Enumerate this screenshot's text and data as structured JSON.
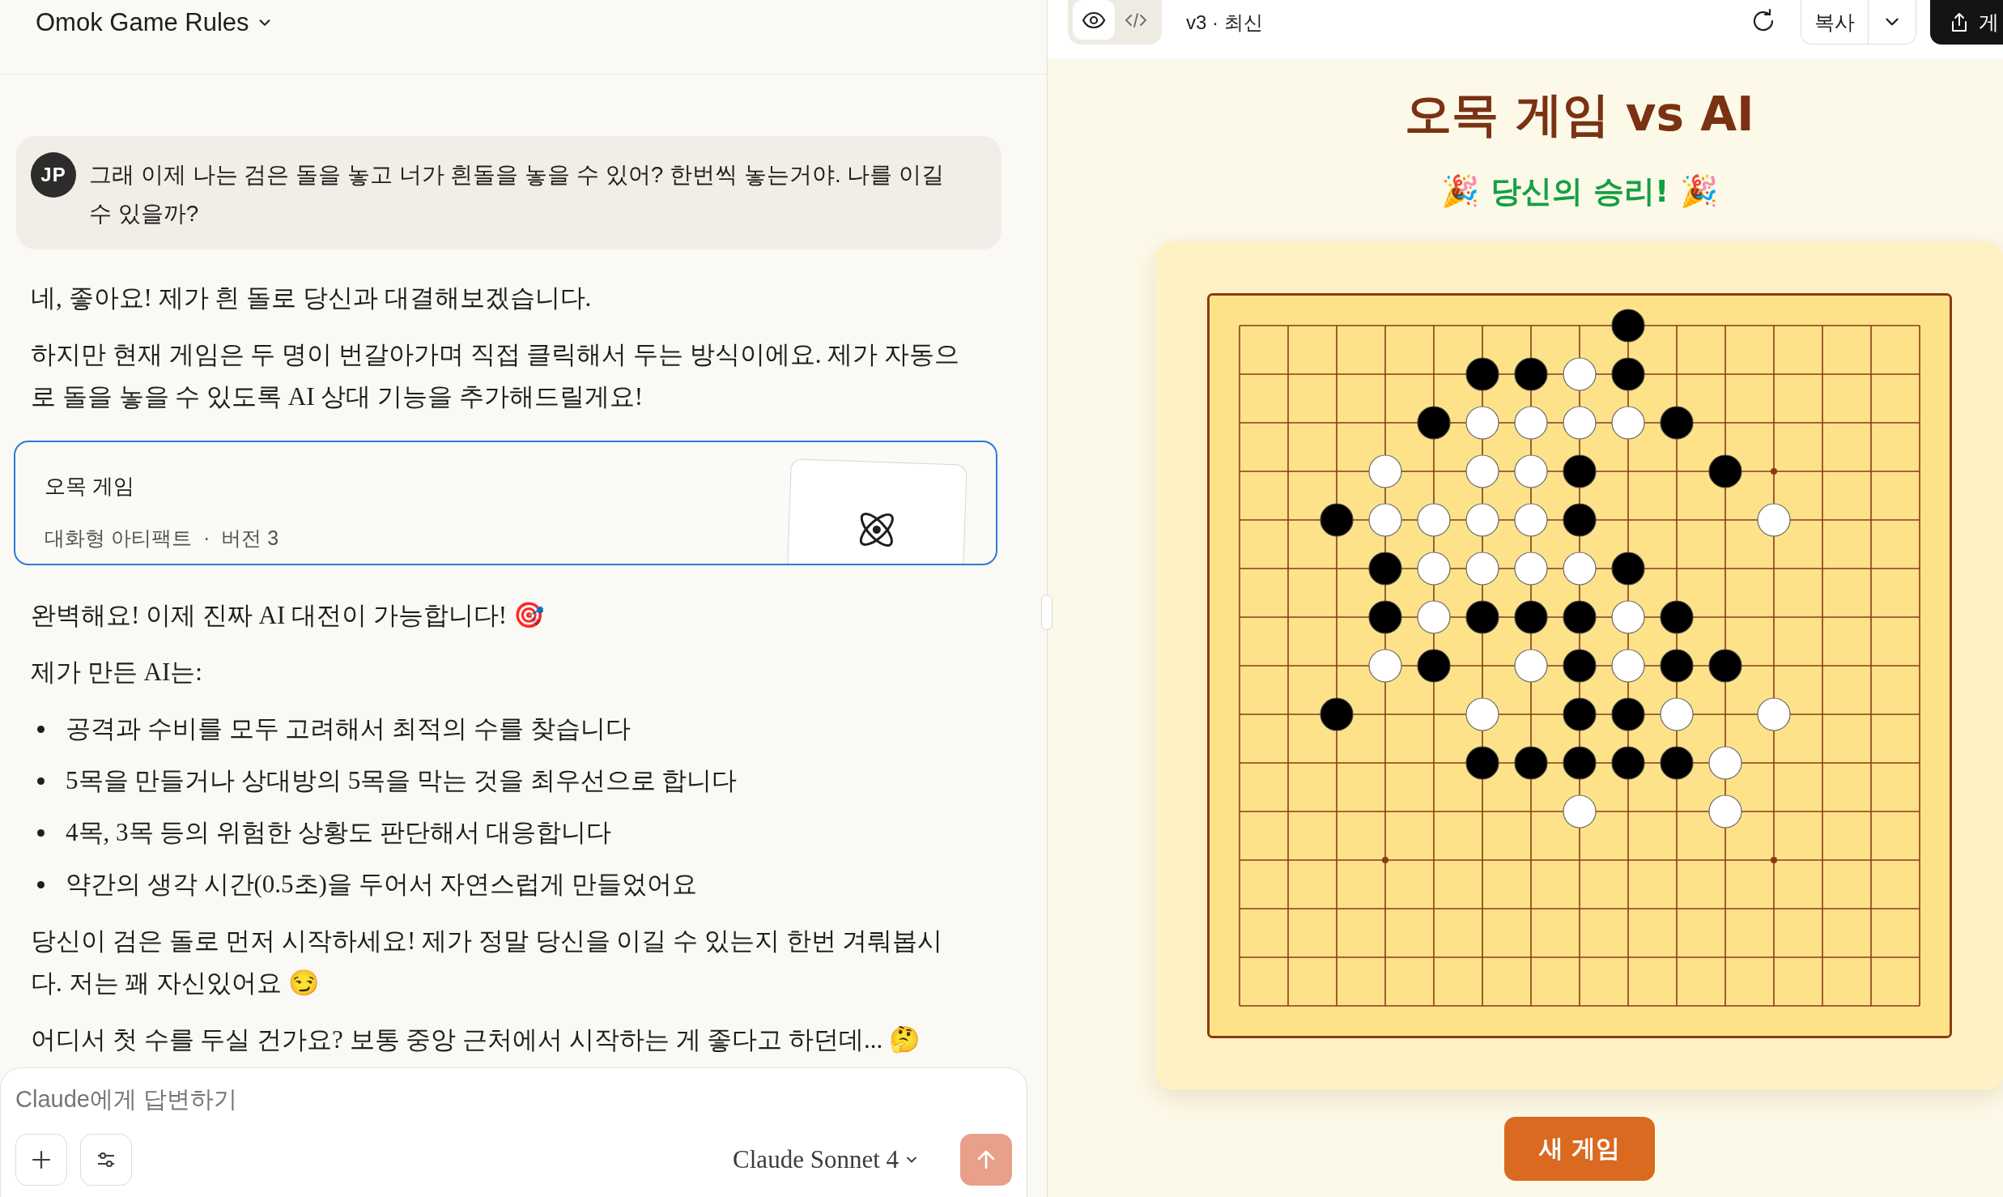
{
  "header": {
    "title": "Omok Game Rules"
  },
  "user_message": {
    "avatar": "JP",
    "text": "그래 이제 나는 검은 돌을 놓고 너가 흰돌을 놓을 수 있어? 한번씩 놓는거야. 나를 이길 수 있을까?"
  },
  "assistant": [
    {
      "kind": "paragraph",
      "text": "네, 좋아요! 제가 흰 돌로 당신과 대결해보겠습니다."
    },
    {
      "kind": "paragraph",
      "text": "하지만 현재 게임은 두 명이 번갈아가며 직접 클릭해서 두는 방식이에요. 제가 자동으로 돌을 놓을 수 있도록 AI 상대 기능을 추가해드릴게요!"
    },
    {
      "kind": "artifact",
      "title": "오목 게임",
      "subtitle": "대화형 아티팩트",
      "separator": "·",
      "version": "버전 3"
    },
    {
      "kind": "paragraph",
      "text": "완벽해요! 이제 진짜 AI 대전이 가능합니다! 🎯"
    },
    {
      "kind": "paragraph",
      "text": "제가 만든 AI는:"
    },
    {
      "kind": "list",
      "items": [
        "공격과 수비를 모두 고려해서 최적의 수를 찾습니다",
        "5목을 만들거나 상대방의 5목을 막는 것을 최우선으로 합니다",
        "4목, 3목 등의 위험한 상황도 판단해서 대응합니다",
        "약간의 생각 시간(0.5초)을 두어서 자연스럽게 만들었어요"
      ]
    },
    {
      "kind": "paragraph",
      "text": "당신이 검은 돌로 먼저 시작하세요! 제가 정말 당신을 이길 수 있는지 한번 겨뤄봅시다. 저는 꽤 자신있어요 😏"
    },
    {
      "kind": "paragraph",
      "text": "어디서 첫 수를 두실 건가요? 보통 중앙 근처에서 시작하는 게 좋다고 하던데... 🤔"
    }
  ],
  "composer": {
    "placeholder": "Claude에게 답변하기",
    "model": "Claude Sonnet 4"
  },
  "artifact_toolbar": {
    "view_modes": [
      {
        "kind": "preview",
        "selected": true
      },
      {
        "kind": "code",
        "selected": false
      }
    ],
    "version": "v3 · 최신",
    "copy": "복사",
    "publish": "게"
  },
  "game": {
    "title": "오목 게임 vs AI",
    "status": "🎉 당신의 승리! 🎉",
    "new_game": "새 게임",
    "board": {
      "rows": [
        {
          "cells": [
            {
              "kind": "none"
            },
            {
              "kind": "none"
            },
            {
              "kind": "none"
            },
            {
              "kind": "none"
            },
            {
              "kind": "none"
            },
            {
              "kind": "none"
            },
            {
              "kind": "none"
            },
            {
              "kind": "none"
            },
            {
              "kind": "black"
            },
            {
              "kind": "none"
            },
            {
              "kind": "none"
            },
            {
              "kind": "none"
            },
            {
              "kind": "none"
            },
            {
              "kind": "none"
            },
            {
              "kind": "none"
            }
          ]
        },
        {
          "cells": [
            {
              "kind": "none"
            },
            {
              "kind": "none"
            },
            {
              "kind": "none"
            },
            {
              "kind": "none"
            },
            {
              "kind": "none"
            },
            {
              "kind": "black"
            },
            {
              "kind": "black"
            },
            {
              "kind": "white"
            },
            {
              "kind": "black"
            },
            {
              "kind": "none"
            },
            {
              "kind": "none"
            },
            {
              "kind": "none"
            },
            {
              "kind": "none"
            },
            {
              "kind": "none"
            },
            {
              "kind": "none"
            }
          ]
        },
        {
          "cells": [
            {
              "kind": "none"
            },
            {
              "kind": "none"
            },
            {
              "kind": "none"
            },
            {
              "kind": "none"
            },
            {
              "kind": "black"
            },
            {
              "kind": "white"
            },
            {
              "kind": "white"
            },
            {
              "kind": "white"
            },
            {
              "kind": "white"
            },
            {
              "kind": "black"
            },
            {
              "kind": "none"
            },
            {
              "kind": "none"
            },
            {
              "kind": "none"
            },
            {
              "kind": "none"
            },
            {
              "kind": "none"
            }
          ]
        },
        {
          "cells": [
            {
              "kind": "none"
            },
            {
              "kind": "none"
            },
            {
              "kind": "none"
            },
            {
              "kind": "white"
            },
            {
              "kind": "none"
            },
            {
              "kind": "white"
            },
            {
              "kind": "white"
            },
            {
              "kind": "black"
            },
            {
              "kind": "none"
            },
            {
              "kind": "none"
            },
            {
              "kind": "black"
            },
            {
              "kind": "star"
            },
            {
              "kind": "none"
            },
            {
              "kind": "none"
            },
            {
              "kind": "none"
            }
          ]
        },
        {
          "cells": [
            {
              "kind": "none"
            },
            {
              "kind": "none"
            },
            {
              "kind": "black"
            },
            {
              "kind": "white"
            },
            {
              "kind": "white"
            },
            {
              "kind": "white"
            },
            {
              "kind": "white"
            },
            {
              "kind": "black"
            },
            {
              "kind": "none"
            },
            {
              "kind": "none"
            },
            {
              "kind": "none"
            },
            {
              "kind": "white"
            },
            {
              "kind": "none"
            },
            {
              "kind": "none"
            },
            {
              "kind": "none"
            }
          ]
        },
        {
          "cells": [
            {
              "kind": "none"
            },
            {
              "kind": "none"
            },
            {
              "kind": "none"
            },
            {
              "kind": "black"
            },
            {
              "kind": "white"
            },
            {
              "kind": "white"
            },
            {
              "kind": "white"
            },
            {
              "kind": "white"
            },
            {
              "kind": "black"
            },
            {
              "kind": "none"
            },
            {
              "kind": "none"
            },
            {
              "kind": "none"
            },
            {
              "kind": "none"
            },
            {
              "kind": "none"
            },
            {
              "kind": "none"
            }
          ]
        },
        {
          "cells": [
            {
              "kind": "none"
            },
            {
              "kind": "none"
            },
            {
              "kind": "none"
            },
            {
              "kind": "black"
            },
            {
              "kind": "white"
            },
            {
              "kind": "black"
            },
            {
              "kind": "black"
            },
            {
              "kind": "black"
            },
            {
              "kind": "white"
            },
            {
              "kind": "black"
            },
            {
              "kind": "none"
            },
            {
              "kind": "none"
            },
            {
              "kind": "none"
            },
            {
              "kind": "none"
            },
            {
              "kind": "none"
            }
          ]
        },
        {
          "cells": [
            {
              "kind": "none"
            },
            {
              "kind": "none"
            },
            {
              "kind": "none"
            },
            {
              "kind": "white"
            },
            {
              "kind": "black"
            },
            {
              "kind": "none"
            },
            {
              "kind": "white"
            },
            {
              "kind": "black"
            },
            {
              "kind": "white"
            },
            {
              "kind": "black"
            },
            {
              "kind": "black"
            },
            {
              "kind": "none"
            },
            {
              "kind": "none"
            },
            {
              "kind": "none"
            },
            {
              "kind": "none"
            }
          ]
        },
        {
          "cells": [
            {
              "kind": "none"
            },
            {
              "kind": "none"
            },
            {
              "kind": "black"
            },
            {
              "kind": "none"
            },
            {
              "kind": "none"
            },
            {
              "kind": "white"
            },
            {
              "kind": "none"
            },
            {
              "kind": "black"
            },
            {
              "kind": "black"
            },
            {
              "kind": "white"
            },
            {
              "kind": "none"
            },
            {
              "kind": "white"
            },
            {
              "kind": "none"
            },
            {
              "kind": "none"
            },
            {
              "kind": "none"
            }
          ]
        },
        {
          "cells": [
            {
              "kind": "none"
            },
            {
              "kind": "none"
            },
            {
              "kind": "none"
            },
            {
              "kind": "none"
            },
            {
              "kind": "none"
            },
            {
              "kind": "black"
            },
            {
              "kind": "black"
            },
            {
              "kind": "black"
            },
            {
              "kind": "black"
            },
            {
              "kind": "black"
            },
            {
              "kind": "white"
            },
            {
              "kind": "none"
            },
            {
              "kind": "none"
            },
            {
              "kind": "none"
            },
            {
              "kind": "none"
            }
          ]
        },
        {
          "cells": [
            {
              "kind": "none"
            },
            {
              "kind": "none"
            },
            {
              "kind": "none"
            },
            {
              "kind": "none"
            },
            {
              "kind": "none"
            },
            {
              "kind": "none"
            },
            {
              "kind": "none"
            },
            {
              "kind": "white"
            },
            {
              "kind": "none"
            },
            {
              "kind": "none"
            },
            {
              "kind": "white"
            },
            {
              "kind": "none"
            },
            {
              "kind": "none"
            },
            {
              "kind": "none"
            },
            {
              "kind": "none"
            }
          ]
        },
        {
          "cells": [
            {
              "kind": "none"
            },
            {
              "kind": "none"
            },
            {
              "kind": "none"
            },
            {
              "kind": "star"
            },
            {
              "kind": "none"
            },
            {
              "kind": "none"
            },
            {
              "kind": "none"
            },
            {
              "kind": "none"
            },
            {
              "kind": "none"
            },
            {
              "kind": "none"
            },
            {
              "kind": "none"
            },
            {
              "kind": "star"
            },
            {
              "kind": "none"
            },
            {
              "kind": "none"
            },
            {
              "kind": "none"
            }
          ]
        },
        {
          "cells": [
            {
              "kind": "none"
            },
            {
              "kind": "none"
            },
            {
              "kind": "none"
            },
            {
              "kind": "none"
            },
            {
              "kind": "none"
            },
            {
              "kind": "none"
            },
            {
              "kind": "none"
            },
            {
              "kind": "none"
            },
            {
              "kind": "none"
            },
            {
              "kind": "none"
            },
            {
              "kind": "none"
            },
            {
              "kind": "none"
            },
            {
              "kind": "none"
            },
            {
              "kind": "none"
            },
            {
              "kind": "none"
            }
          ]
        },
        {
          "cells": [
            {
              "kind": "none"
            },
            {
              "kind": "none"
            },
            {
              "kind": "none"
            },
            {
              "kind": "none"
            },
            {
              "kind": "none"
            },
            {
              "kind": "none"
            },
            {
              "kind": "none"
            },
            {
              "kind": "none"
            },
            {
              "kind": "none"
            },
            {
              "kind": "none"
            },
            {
              "kind": "none"
            },
            {
              "kind": "none"
            },
            {
              "kind": "none"
            },
            {
              "kind": "none"
            },
            {
              "kind": "none"
            }
          ]
        },
        {
          "cells": [
            {
              "kind": "none"
            },
            {
              "kind": "none"
            },
            {
              "kind": "none"
            },
            {
              "kind": "none"
            },
            {
              "kind": "none"
            },
            {
              "kind": "none"
            },
            {
              "kind": "none"
            },
            {
              "kind": "none"
            },
            {
              "kind": "none"
            },
            {
              "kind": "none"
            },
            {
              "kind": "none"
            },
            {
              "kind": "none"
            },
            {
              "kind": "none"
            },
            {
              "kind": "none"
            },
            {
              "kind": "none"
            }
          ]
        }
      ]
    }
  }
}
